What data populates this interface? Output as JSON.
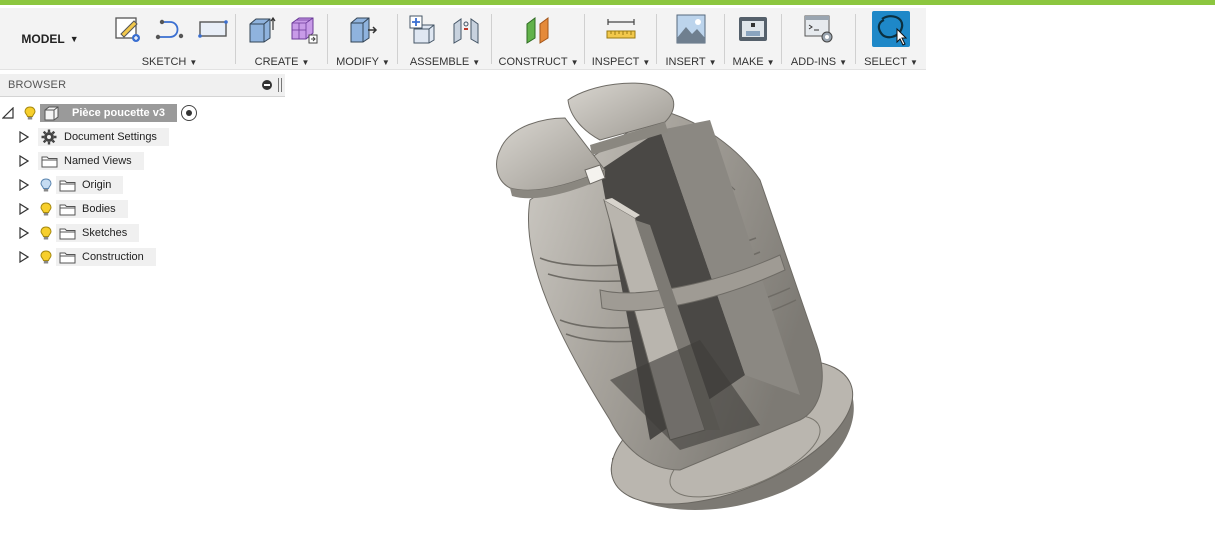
{
  "toolbar": {
    "mode": {
      "label": "MODEL"
    },
    "groups": {
      "sketch": {
        "label": "SKETCH"
      },
      "create": {
        "label": "CREATE"
      },
      "modify": {
        "label": "MODIFY"
      },
      "assemble": {
        "label": "ASSEMBLE"
      },
      "construct": {
        "label": "CONSTRUCT"
      },
      "inspect": {
        "label": "INSPECT"
      },
      "insert": {
        "label": "INSERT"
      },
      "make": {
        "label": "MAKE"
      },
      "addins": {
        "label": "ADD-INS"
      },
      "select": {
        "label": "SELECT"
      }
    },
    "accent_color": "#1e88c8",
    "brand_bar_color": "#8cc63f"
  },
  "browser": {
    "title": "BROWSER",
    "root": {
      "label": "Pièce poucette v3"
    },
    "items": [
      {
        "label": "Document Settings",
        "icon": "gear-icon"
      },
      {
        "label": "Named Views",
        "icon": "folder-icon"
      },
      {
        "label": "Origin",
        "icon": "folder-icon",
        "bulb": "off"
      },
      {
        "label": "Bodies",
        "icon": "folder-icon",
        "bulb": "on"
      },
      {
        "label": "Sketches",
        "icon": "folder-icon",
        "bulb": "on"
      },
      {
        "label": "Construction",
        "icon": "folder-icon",
        "bulb": "on"
      }
    ]
  }
}
